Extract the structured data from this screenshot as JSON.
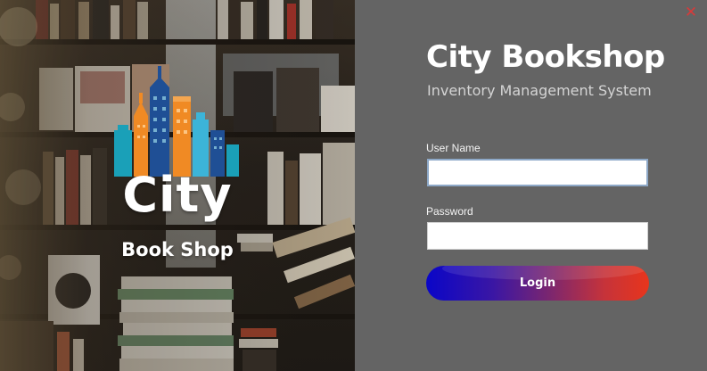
{
  "window": {
    "close_glyph": "✕"
  },
  "branding": {
    "logo_word": "City",
    "logo_sub": "Book Shop",
    "logo_colors": {
      "teal": "#1aa0b8",
      "orange": "#f08a24",
      "navy": "#1f4f95",
      "light_blue": "#3cb4d8"
    }
  },
  "form": {
    "title": "City Bookshop",
    "subtitle": "Inventory Management System",
    "username_label": "User Name",
    "username_value": "",
    "password_label": "Password",
    "password_value": "",
    "login_label": "Login",
    "login_gradient": [
      "#0a06c8",
      "#e8351c"
    ]
  },
  "colors": {
    "panel_background": "#646464",
    "close_icon": "#d83a3a",
    "input_focus_border": "#8ea9c8"
  }
}
